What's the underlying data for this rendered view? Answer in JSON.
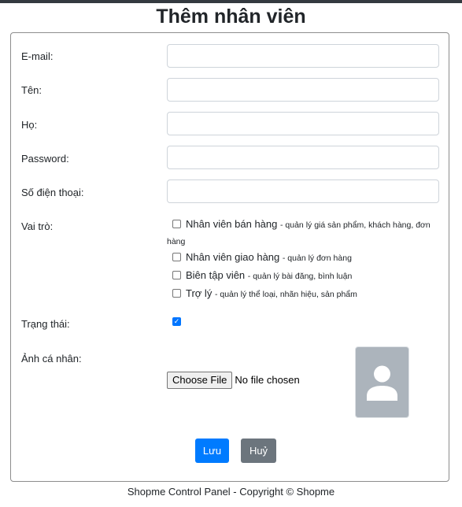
{
  "title": "Thêm nhân viên",
  "form": {
    "email_label": "E-mail:",
    "first_name_label": "Tên:",
    "last_name_label": "Họ:",
    "password_label": "Password:",
    "phone_label": "Số điện thoại:",
    "roles_label": "Vai trò:",
    "roles": [
      {
        "name": "Nhân viên bán hàng",
        "desc": "- quản lý giá sản phẩm, khách hàng, đơn hàng",
        "checked": false
      },
      {
        "name": "Nhân viên giao hàng",
        "desc": "- quản lý đơn hàng",
        "checked": false
      },
      {
        "name": "Biên tập viên",
        "desc": "- quản lý bài đăng, bình luận",
        "checked": false
      },
      {
        "name": "Trợ lý",
        "desc": "- quản lý thể loại, nhãn hiệu, sản phẩm",
        "checked": false
      }
    ],
    "status_label": "Trạng thái:",
    "status_checked": true,
    "photo_label": "Ảnh cá nhân:",
    "choose_file_label": "Choose File",
    "file_status": "No file chosen",
    "save_label": "Lưu",
    "cancel_label": "Huỷ"
  },
  "colors": {
    "primary": "#007bff",
    "secondary": "#6c757d",
    "avatar_bg": "#acb4bc"
  },
  "footer": "Shopme Control Panel - Copyright © Shopme"
}
